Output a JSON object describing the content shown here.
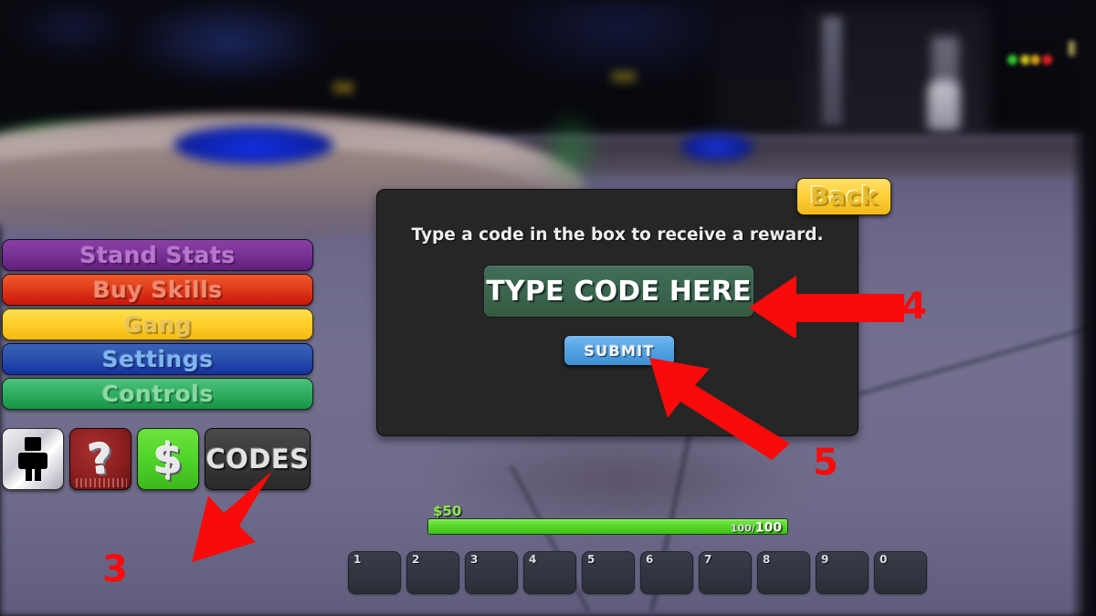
{
  "scene": {
    "game_background": "blurred-roblox-city-plaza-night",
    "accent_red": "#fa0a0a",
    "accent_green_bar": "#58d92b",
    "accent_blue_button": "#54a3e3",
    "accent_gold_button": "#ffd13a"
  },
  "menu": {
    "buttons": [
      {
        "label": "Stand Stats",
        "color": "#7a3396"
      },
      {
        "label": "Buy Skills",
        "color": "#e03d1c"
      },
      {
        "label": "Gang",
        "color": "#ffcf2c"
      },
      {
        "label": "Settings",
        "color": "#2c52ad"
      },
      {
        "label": "Controls",
        "color": "#33b064"
      }
    ]
  },
  "icon_row": {
    "items": [
      {
        "name": "avatar-icon",
        "label": ""
      },
      {
        "name": "question-icon",
        "label": "?"
      },
      {
        "name": "money-icon",
        "label": "$"
      },
      {
        "name": "codes-button",
        "label": "CODES"
      }
    ]
  },
  "code_dialog": {
    "heading": "Type a code in the box to receive a reward.",
    "input_value": "TYPE CODE HERE",
    "input_placeholder": "TYPE CODE HERE",
    "submit_label": "SUBMIT",
    "back_label": "Back"
  },
  "hud": {
    "money": "$50",
    "health_current": "100",
    "health_separator": "/",
    "health_max": "100",
    "hotbar_slots": [
      "1",
      "2",
      "3",
      "4",
      "5",
      "6",
      "7",
      "8",
      "9",
      "0"
    ]
  },
  "annotations": {
    "step3": "3",
    "step4": "4",
    "step5": "5"
  }
}
